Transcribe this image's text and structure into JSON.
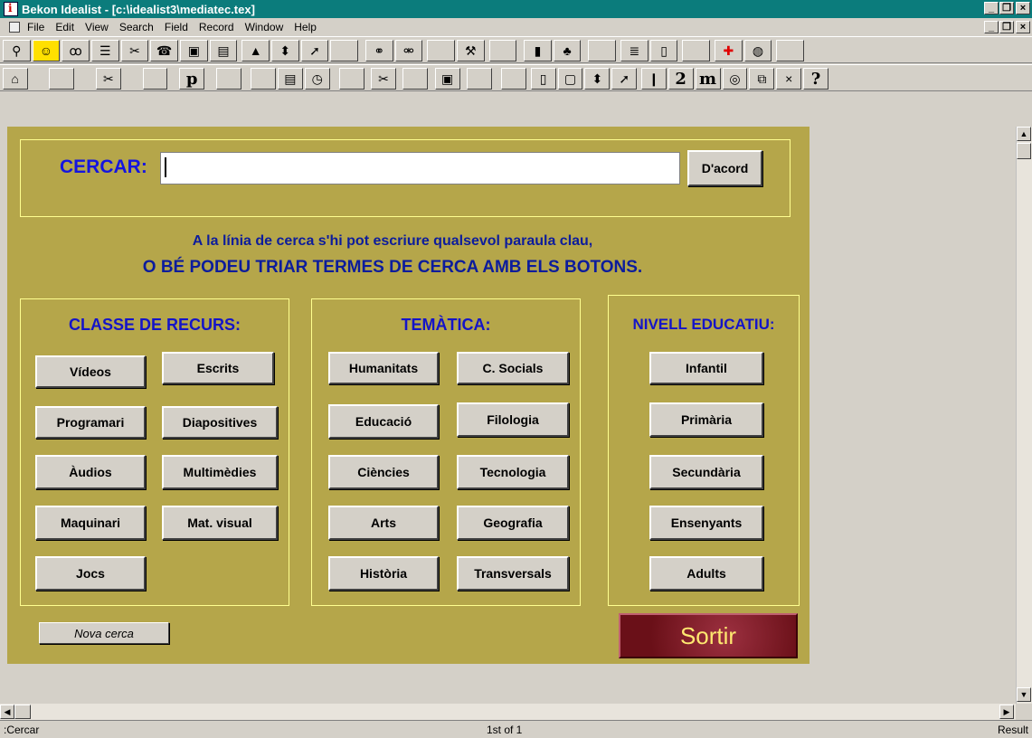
{
  "window": {
    "title": "Bekon Idealist - [c:\\idealist3\\mediatec.tex]",
    "minimize": "_",
    "restore": "̅❐",
    "close": "×"
  },
  "menu": [
    "File",
    "Edit",
    "View",
    "Search",
    "Field",
    "Record",
    "Window",
    "Help"
  ],
  "toolbar1": [
    {
      "name": "search-icon",
      "glyph": "⚲"
    },
    {
      "name": "smiley-icon",
      "glyph": "☺"
    },
    {
      "name": "glasses-icon",
      "glyph": "ꝏ"
    },
    {
      "name": "list-icon",
      "glyph": "☰"
    },
    {
      "name": "tools-icon",
      "glyph": "✂"
    },
    {
      "name": "phone-icon",
      "glyph": "☎"
    },
    {
      "name": "save-icon",
      "glyph": "▣"
    },
    {
      "name": "form-icon",
      "glyph": "▤"
    },
    {
      "name": "arrow-up-icon",
      "glyph": "▲"
    },
    {
      "name": "up-down-icon",
      "glyph": "⬍"
    },
    {
      "name": "pointer-icon",
      "glyph": "➚"
    },
    {
      "name": "blank-icon",
      "glyph": ""
    },
    {
      "name": "link-icon",
      "glyph": "⚭"
    },
    {
      "name": "unlink-icon",
      "glyph": "⚮"
    },
    {
      "name": "blank-icon",
      "glyph": ""
    },
    {
      "name": "wrench-icon",
      "glyph": "⚒"
    },
    {
      "name": "blank-icon",
      "glyph": ""
    },
    {
      "name": "book-icon",
      "glyph": "▮"
    },
    {
      "name": "tree-icon",
      "glyph": "♣"
    },
    {
      "name": "blank-icon",
      "glyph": ""
    },
    {
      "name": "text-icon",
      "glyph": "≣"
    },
    {
      "name": "notes-icon",
      "glyph": "▯"
    },
    {
      "name": "blank-icon",
      "glyph": ""
    },
    {
      "name": "first-aid-icon",
      "glyph": "✚"
    },
    {
      "name": "globe-icon",
      "glyph": "◍"
    },
    {
      "name": "blank-icon",
      "glyph": ""
    }
  ],
  "toolbar2": [
    {
      "name": "home-icon",
      "glyph": "⌂"
    },
    {
      "name": "blank-icon",
      "glyph": ""
    },
    {
      "name": "tools-icon",
      "glyph": "✂"
    },
    {
      "name": "blank-icon",
      "glyph": ""
    },
    {
      "name": "paragraph-icon",
      "glyph": "p"
    },
    {
      "name": "blank-icon",
      "glyph": ""
    },
    {
      "name": "blank-icon",
      "glyph": ""
    },
    {
      "name": "form-icon",
      "glyph": "▤"
    },
    {
      "name": "clock-icon",
      "glyph": "◷"
    },
    {
      "name": "blank-icon",
      "glyph": ""
    },
    {
      "name": "scissors-icon",
      "glyph": "✂"
    },
    {
      "name": "blank-icon",
      "glyph": ""
    },
    {
      "name": "save-icon",
      "glyph": "▣"
    },
    {
      "name": "blank-icon",
      "glyph": ""
    },
    {
      "name": "blank-icon",
      "glyph": ""
    },
    {
      "name": "notes-icon",
      "glyph": "▯"
    },
    {
      "name": "new-doc-icon",
      "glyph": "▢"
    },
    {
      "name": "up-down-icon",
      "glyph": "⬍"
    },
    {
      "name": "pointer-icon",
      "glyph": "➚"
    },
    {
      "name": "pencil-icon",
      "glyph": "❙"
    },
    {
      "name": "two-icon",
      "glyph": "2"
    },
    {
      "name": "m-icon",
      "glyph": "m"
    },
    {
      "name": "stack-icon",
      "glyph": "◎"
    },
    {
      "name": "copy-icon",
      "glyph": "⧉"
    },
    {
      "name": "close-icon",
      "glyph": "×"
    },
    {
      "name": "help-icon",
      "glyph": "?"
    }
  ],
  "search": {
    "label": "CERCAR:",
    "value": "",
    "ok_label": "D'acord"
  },
  "hints": {
    "line1": "A la línia de cerca s'hi pot escriure qualsevol paraula clau,",
    "line2": "O BÉ PODEU TRIAR TERMES DE CERCA AMB ELS BOTONS."
  },
  "groups": {
    "resource": {
      "title": "CLASSE DE RECURS:",
      "buttons": [
        "Vídeos",
        "Escrits",
        "Programari",
        "Diapositives",
        "Àudios",
        "Multimèdies",
        "Maquinari",
        "Mat. visual",
        "Jocs"
      ]
    },
    "theme": {
      "title": "TEMÀTICA:",
      "buttons": [
        "Humanitats",
        "C. Socials",
        "Educació",
        "Filologia",
        "Ciències",
        "Tecnologia",
        "Arts",
        "Geografia",
        "Història",
        "Transversals"
      ]
    },
    "level": {
      "title": "NIVELL EDUCATIU:",
      "buttons": [
        "Infantil",
        "Primària",
        "Secundària",
        "Ensenyants",
        "Adults"
      ]
    }
  },
  "actions": {
    "new_search": "Nova cerca",
    "exit": "Sortir"
  },
  "status": {
    "left": ":Cercar",
    "center": "1st of 1",
    "right": "Result"
  },
  "colors": {
    "titlebar": "#0b7c7c",
    "panel": "#b5a64a",
    "label_blue": "#1414e0",
    "hint_blue": "#0c1c9c",
    "exit_red": "#7a1820",
    "exit_text": "#ffe870"
  }
}
